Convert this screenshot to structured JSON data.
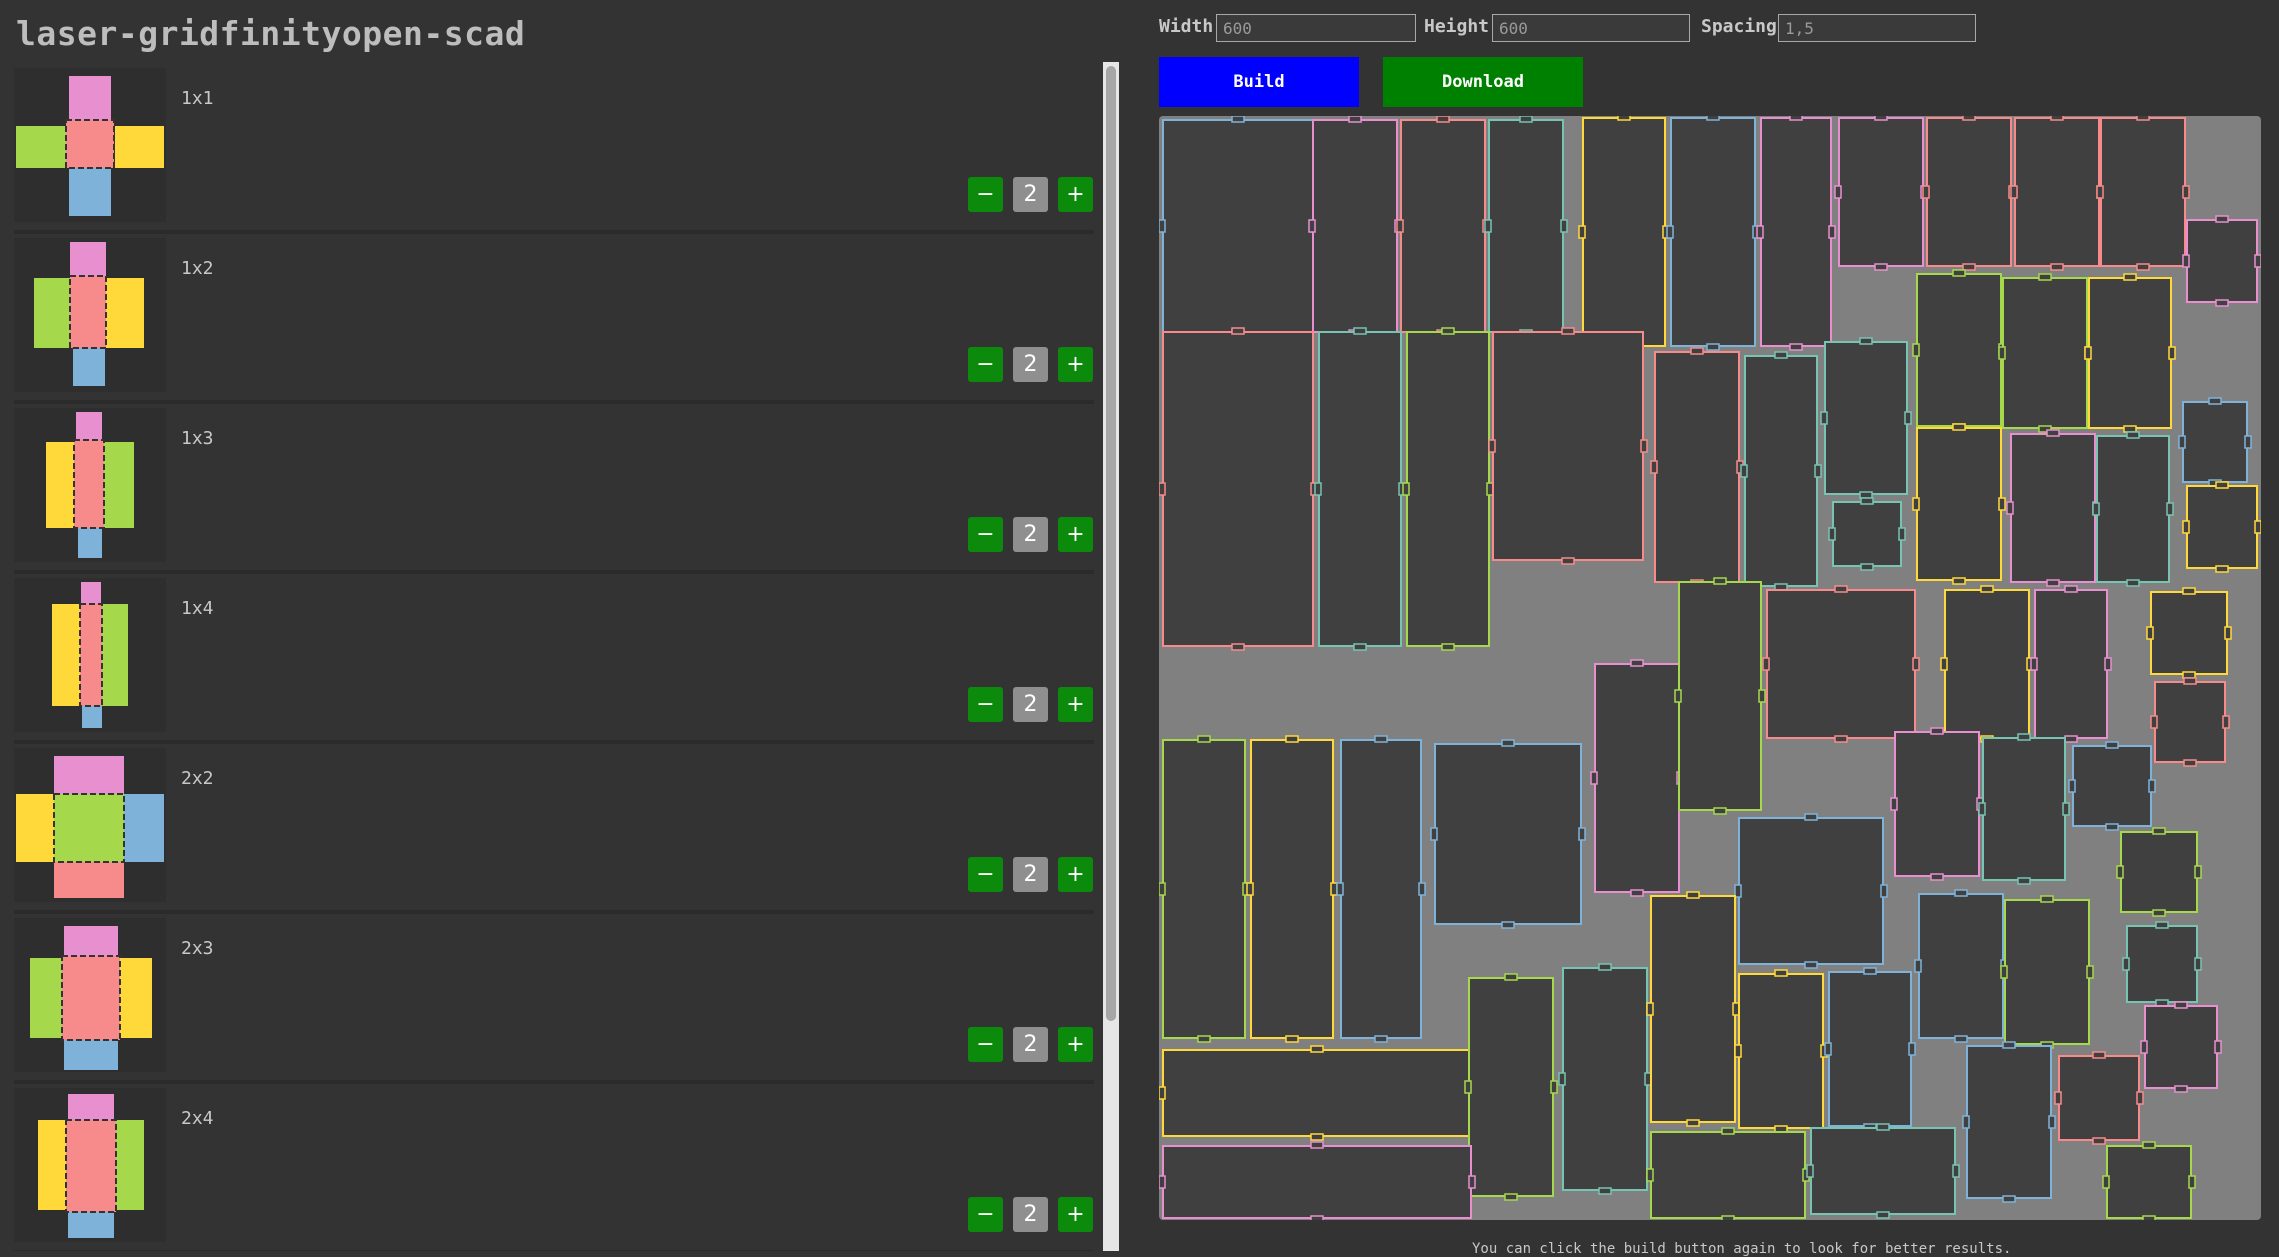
{
  "app": {
    "title": "laser-gridfinityopen-scad"
  },
  "items": [
    {
      "label": "1x1",
      "quantity": "2",
      "minus": "−",
      "plus": "+"
    },
    {
      "label": "1x2",
      "quantity": "2",
      "minus": "−",
      "plus": "+"
    },
    {
      "label": "1x3",
      "quantity": "2",
      "minus": "−",
      "plus": "+"
    },
    {
      "label": "1x4",
      "quantity": "2",
      "minus": "−",
      "plus": "+"
    },
    {
      "label": "2x2",
      "quantity": "2",
      "minus": "−",
      "plus": "+"
    },
    {
      "label": "2x3",
      "quantity": "2",
      "minus": "−",
      "plus": "+"
    },
    {
      "label": "2x4",
      "quantity": "2",
      "minus": "−",
      "plus": "+"
    }
  ],
  "controls": {
    "width_label": "Width",
    "width_value": "600",
    "height_label": "Height",
    "height_value": "600",
    "spacing_label": "Spacing",
    "spacing_value": "1,5",
    "build_label": "Build",
    "download_label": "Download"
  },
  "hint": "You can click the build button again to look for better results.",
  "colors": {
    "background": "#333333",
    "canvas": "#808080",
    "piece_fill": "#404040",
    "pink": "#e88fcf",
    "salmon": "#f78a8a",
    "yellow": "#ffd83a",
    "green": "#a6d84c",
    "blue": "#7fb2d8",
    "teal": "#78c4b2",
    "button_green": "#0b8a0b",
    "build_blue": "#0000ff",
    "download_green": "#008000"
  }
}
